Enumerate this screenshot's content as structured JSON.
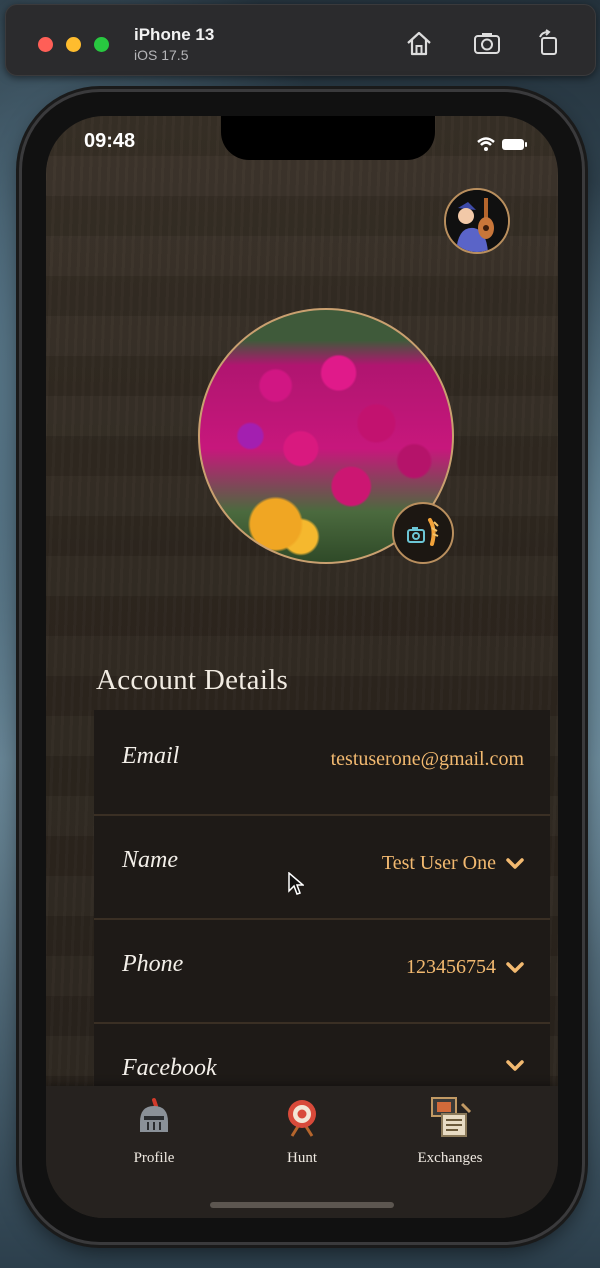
{
  "simulator": {
    "device": "iPhone 13",
    "os": "iOS 17.5",
    "buttons": [
      "home-icon",
      "screenshot-icon",
      "rotate-icon"
    ]
  },
  "status_bar": {
    "time": "09:48"
  },
  "account": {
    "title": "Account Details",
    "rows": [
      {
        "label": "Email",
        "value": "testuserone@gmail.com",
        "chevron": false
      },
      {
        "label": "Name",
        "value": "Test User One",
        "chevron": true
      },
      {
        "label": "Phone",
        "value": "123456754",
        "chevron": true
      },
      {
        "label": "Facebook",
        "value": "",
        "chevron": true
      }
    ]
  },
  "tabs": [
    {
      "label": "Profile",
      "icon": "helmet-icon"
    },
    {
      "label": "Hunt",
      "icon": "target-icon"
    },
    {
      "label": "Exchanges",
      "icon": "scroll-icon"
    }
  ],
  "colors": {
    "accent": "#f2b970",
    "panel": "#1e1a17",
    "text": "#f3efe9"
  }
}
